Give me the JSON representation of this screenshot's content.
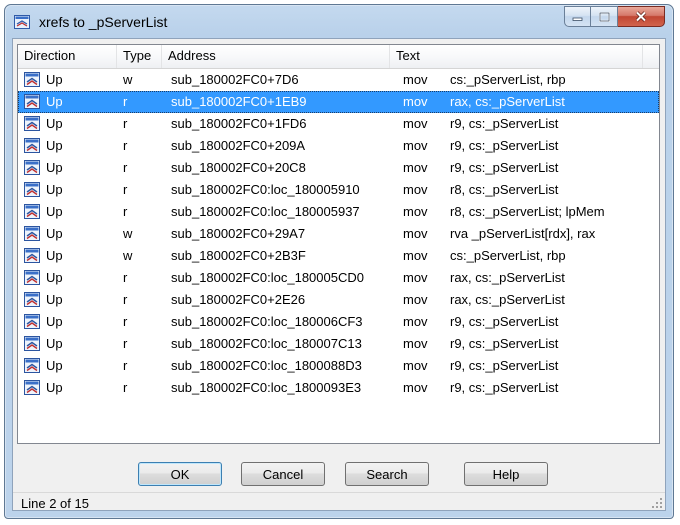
{
  "window": {
    "title": "xrefs to _pServerList"
  },
  "caption": {
    "minimize_icon": "minimize-icon",
    "maximize_icon": "maximize-icon",
    "close_icon": "close-icon"
  },
  "columns": [
    "Direction",
    "Type",
    "Address",
    "Text"
  ],
  "rows": [
    {
      "direction": "Up",
      "type": "w",
      "address": "sub_180002FC0+7D6",
      "mnemonic": "mov",
      "operands": "cs:_pServerList, rbp",
      "selected": false
    },
    {
      "direction": "Up",
      "type": "r",
      "address": "sub_180002FC0+1EB9",
      "mnemonic": "mov",
      "operands": "rax, cs:_pServerList",
      "selected": true
    },
    {
      "direction": "Up",
      "type": "r",
      "address": "sub_180002FC0+1FD6",
      "mnemonic": "mov",
      "operands": "r9, cs:_pServerList",
      "selected": false
    },
    {
      "direction": "Up",
      "type": "r",
      "address": "sub_180002FC0+209A",
      "mnemonic": "mov",
      "operands": "r9, cs:_pServerList",
      "selected": false
    },
    {
      "direction": "Up",
      "type": "r",
      "address": "sub_180002FC0+20C8",
      "mnemonic": "mov",
      "operands": "r9, cs:_pServerList",
      "selected": false
    },
    {
      "direction": "Up",
      "type": "r",
      "address": "sub_180002FC0:loc_180005910",
      "mnemonic": "mov",
      "operands": "r8, cs:_pServerList",
      "selected": false
    },
    {
      "direction": "Up",
      "type": "r",
      "address": "sub_180002FC0:loc_180005937",
      "mnemonic": "mov",
      "operands": "r8, cs:_pServerList; lpMem",
      "selected": false
    },
    {
      "direction": "Up",
      "type": "w",
      "address": "sub_180002FC0+29A7",
      "mnemonic": "mov",
      "operands": "rva _pServerList[rdx], rax",
      "selected": false
    },
    {
      "direction": "Up",
      "type": "w",
      "address": "sub_180002FC0+2B3F",
      "mnemonic": "mov",
      "operands": "cs:_pServerList, rbp",
      "selected": false
    },
    {
      "direction": "Up",
      "type": "r",
      "address": "sub_180002FC0:loc_180005CD0",
      "mnemonic": "mov",
      "operands": "rax, cs:_pServerList",
      "selected": false
    },
    {
      "direction": "Up",
      "type": "r",
      "address": "sub_180002FC0+2E26",
      "mnemonic": "mov",
      "operands": "rax, cs:_pServerList",
      "selected": false
    },
    {
      "direction": "Up",
      "type": "r",
      "address": "sub_180002FC0:loc_180006CF3",
      "mnemonic": "mov",
      "operands": "r9, cs:_pServerList",
      "selected": false
    },
    {
      "direction": "Up",
      "type": "r",
      "address": "sub_180002FC0:loc_180007C13",
      "mnemonic": "mov",
      "operands": "r9, cs:_pServerList",
      "selected": false
    },
    {
      "direction": "Up",
      "type": "r",
      "address": "sub_180002FC0:loc_1800088D3",
      "mnemonic": "mov",
      "operands": "r9, cs:_pServerList",
      "selected": false
    },
    {
      "direction": "Up",
      "type": "r",
      "address": "sub_180002FC0:loc_1800093E3",
      "mnemonic": "mov",
      "operands": "r9, cs:_pServerList",
      "selected": false
    }
  ],
  "row_icon": "xref-icon",
  "buttons": {
    "ok": "OK",
    "cancel": "Cancel",
    "search": "Search",
    "help": "Help"
  },
  "status": {
    "text": "Line 2 of 15"
  },
  "colors": {
    "selection": "#3399ff",
    "title_bar": "#b9d1ea",
    "close_button": "#c04633"
  }
}
